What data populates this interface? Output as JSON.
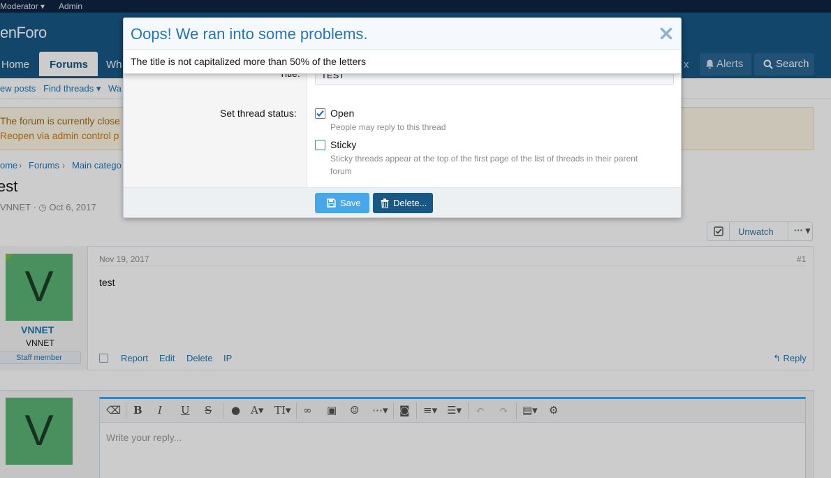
{
  "staffbar": {
    "moderator": "Moderator",
    "admin": "Admin"
  },
  "logo": "enForo",
  "nav": {
    "tabs": [
      "Home",
      "Forums",
      "Wh"
    ],
    "inbox_fragment": "x",
    "alerts": "Alerts",
    "search": "Search"
  },
  "subnav": {
    "new_posts": "ew posts",
    "find_threads": "Find threads",
    "watched": "Wa"
  },
  "notice": {
    "line1": "The forum is currently close",
    "line2": "Reopen via admin control p"
  },
  "breadcrumb": [
    "ome",
    "Forums",
    "Main catego"
  ],
  "thread": {
    "title": "est",
    "author": "VNNET",
    "date": "Oct 6, 2017"
  },
  "watch": {
    "label": "Unwatch"
  },
  "post": {
    "avatar_letter": "V",
    "username": "VNNET",
    "user_title": "VNNET",
    "badge": "Staff member",
    "date": "Nov 19, 2017",
    "number": "#1",
    "body": "test",
    "actions": {
      "report": "Report",
      "edit": "Edit",
      "delete": "Delete",
      "ip": "IP",
      "reply": "Reply"
    }
  },
  "reply": {
    "avatar_letter": "V",
    "placeholder": "Write your reply..."
  },
  "modal": {
    "title_label": "Title:",
    "title_value": "TEST",
    "status_label": "Set thread status:",
    "open_label": "Open",
    "open_hint": "People may reply to this thread",
    "sticky_label": "Sticky",
    "sticky_hint_line1": "Sticky threads appear at the top of the first page of the list of threads in their parent",
    "sticky_hint_line2": "forum",
    "save": "Save",
    "delete": "Delete..."
  },
  "error": {
    "title": "Oops! We ran into some problems.",
    "message": "The title is not capitalized more than 50% of the letters"
  },
  "colors": {
    "header": "#185886",
    "accent": "#2577b1",
    "primary_button": "#47a7eb",
    "avatar": "#5cb477"
  }
}
